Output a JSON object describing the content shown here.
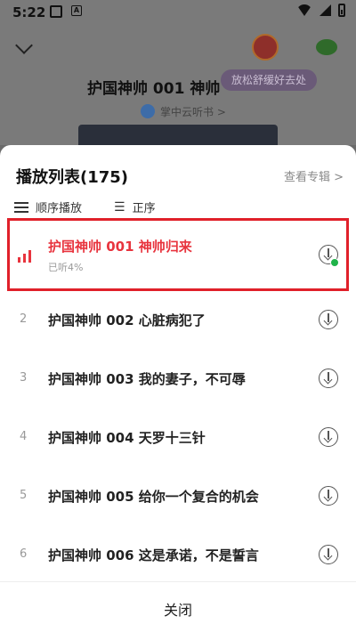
{
  "status": {
    "time": "5:22",
    "sim_icon_letter": "A"
  },
  "player": {
    "title": "护国神帅 001 神帅归来",
    "source": "掌中云听书 >",
    "tooltip": "放松舒缓好去处"
  },
  "playlist": {
    "title": "播放列表(175)",
    "view_album": "查看专辑 >",
    "mode_order": "顺序播放",
    "mode_sort": "正序",
    "tracks": [
      {
        "index": "",
        "name": "护国神帅 001 神帅归来",
        "sub": "已听4%",
        "active": true,
        "downloaded": true
      },
      {
        "index": "2",
        "name": "护国神帅 002 心脏病犯了"
      },
      {
        "index": "3",
        "name": "护国神帅 003 我的妻子，不可辱"
      },
      {
        "index": "4",
        "name": "护国神帅 004 天罗十三针"
      },
      {
        "index": "5",
        "name": "护国神帅 005 给你一个复合的机会"
      },
      {
        "index": "6",
        "name": "护国神帅 006 这是承诺，不是誓言"
      }
    ],
    "close_label": "关闭"
  },
  "colors": {
    "accent": "#e8343e",
    "highlight_frame": "#e0202a",
    "download_done": "#1fb34a"
  }
}
